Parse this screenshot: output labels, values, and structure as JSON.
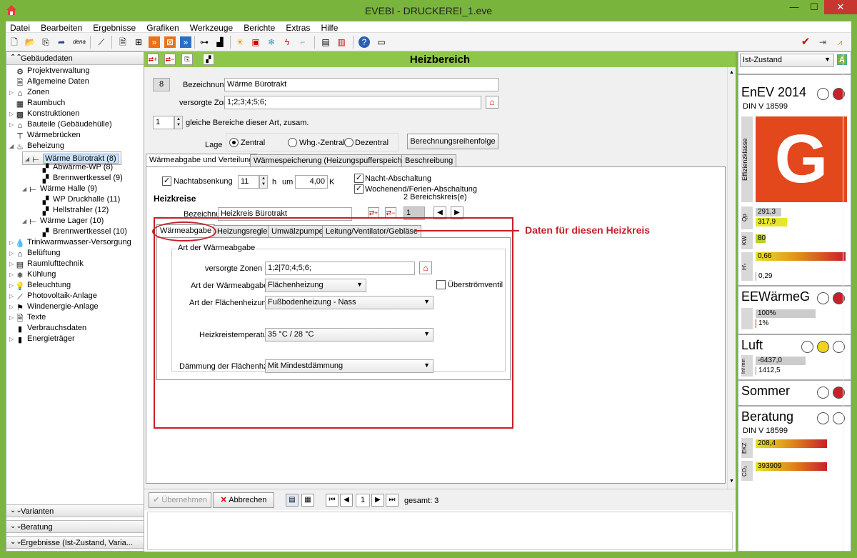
{
  "window": {
    "title": "EVEBI - DRUCKEREI_1.eve",
    "minimize": "—",
    "maximize": "☐",
    "close": "✕"
  },
  "menu": [
    "Datei",
    "Bearbeiten",
    "Ergebnisse",
    "Grafiken",
    "Werkzeuge",
    "Berichte",
    "Extras",
    "Hilfe"
  ],
  "toolbar": {
    "dena_label": "dena"
  },
  "left": {
    "header": "Gebäudedaten",
    "tree": [
      {
        "label": "Projektverwaltung",
        "level": 1,
        "toggle": "",
        "icon": "⚙"
      },
      {
        "label": "Allgemeine Daten",
        "level": 1,
        "toggle": "",
        "icon": "🗎"
      },
      {
        "label": "Zonen",
        "level": 1,
        "toggle": "▷",
        "icon": "⌂"
      },
      {
        "label": "Raumbuch",
        "level": 1,
        "toggle": "",
        "icon": "▦"
      },
      {
        "label": "Konstruktionen",
        "level": 1,
        "toggle": "▷",
        "icon": "▩"
      },
      {
        "label": "Bauteile (Gebäudehülle)",
        "level": 1,
        "toggle": "▷",
        "icon": "⌂"
      },
      {
        "label": "Wärmebrücken",
        "level": 1,
        "toggle": "",
        "icon": "⊤"
      },
      {
        "label": "Beheizung",
        "level": 1,
        "toggle": "◢",
        "icon": "♨"
      },
      {
        "label": "Wärme Bürotrakt (8)",
        "level": 2,
        "toggle": "◢",
        "icon": "⊢",
        "selected": true
      },
      {
        "label": "Abwärme-WP (8)",
        "level": 3,
        "toggle": "",
        "icon": "▞"
      },
      {
        "label": "Brennwertkessel (9)",
        "level": 3,
        "toggle": "",
        "icon": "▞"
      },
      {
        "label": "Wärme Halle (9)",
        "level": 2,
        "toggle": "◢",
        "icon": "⊢"
      },
      {
        "label": "WP Druckhalle (11)",
        "level": 3,
        "toggle": "",
        "icon": "▞"
      },
      {
        "label": "Hellstrahler (12)",
        "level": 3,
        "toggle": "",
        "icon": "▞"
      },
      {
        "label": "Wärme Lager (10)",
        "level": 2,
        "toggle": "◢",
        "icon": "⊢"
      },
      {
        "label": "Brennwertkessel (10)",
        "level": 3,
        "toggle": "",
        "icon": "▞"
      },
      {
        "label": "Trinkwarmwasser-Versorgung",
        "level": 1,
        "toggle": "▷",
        "icon": "💧"
      },
      {
        "label": "Belüftung",
        "level": 1,
        "toggle": "▷",
        "icon": "⌂"
      },
      {
        "label": "Raumlufttechnik",
        "level": 1,
        "toggle": "▷",
        "icon": "▤"
      },
      {
        "label": "Kühlung",
        "level": 1,
        "toggle": "▷",
        "icon": "❄"
      },
      {
        "label": "Beleuchtung",
        "level": 1,
        "toggle": "▷",
        "icon": "💡"
      },
      {
        "label": "Photovoltaik-Anlage",
        "level": 1,
        "toggle": "▷",
        "icon": "⟋"
      },
      {
        "label": "Windenergie-Anlage",
        "level": 1,
        "toggle": "▷",
        "icon": "⚑"
      },
      {
        "label": "Texte",
        "level": 1,
        "toggle": "▷",
        "icon": "🗎"
      },
      {
        "label": "Verbrauchsdaten",
        "level": 1,
        "toggle": "",
        "icon": "▮"
      },
      {
        "label": "Energieträger",
        "level": 1,
        "toggle": "▷",
        "icon": "▮"
      }
    ],
    "bottom_sections": [
      "Varianten",
      "Beratung",
      "Ergebnisse (Ist-Zustand, Varia..."
    ]
  },
  "main": {
    "title": "Heizbereich",
    "number": "8",
    "bezeichnung_label": "Bezeichnung",
    "bezeichnung_value": "Wärme Bürotrakt",
    "zonen_label": "versorgte Zonen",
    "zonen_value": "1;2;3;4;5;6;",
    "count_value": "1",
    "count_label": "gleiche Bereiche dieser Art, zusam.",
    "lage_label": "Lage",
    "lage_options": [
      "Zentral",
      "Whg.-Zentral",
      "Dezentral"
    ],
    "reihenfolge_button": "Berechnungsreihenfolge",
    "tabs": [
      "Wärmeabgabe und Verteilung",
      "Wärmespeicherung (Heizungspufferspeicher)",
      "Beschreibung"
    ],
    "nachtabsenkung_label": "Nachtabsenkung",
    "nacht_hours": "11",
    "h_label": "h",
    "um_label": "um",
    "kelvin_value": "4,00",
    "k_label": "K",
    "nacht_abschaltung": "Nacht-Abschaltung",
    "wochenend": "Wochenend/Ferien-Abschaltung",
    "heizkreise_heading": "Heizkreise",
    "bereichskreis": "2 Bereichskreis(e)",
    "hk_label": "Bezeichnung",
    "hk_value": "Heizkreis Bürotrakt",
    "hk_index": "1",
    "annotation": "Daten für diesen Heizkreis",
    "subtabs": [
      "Wärmeabgabe",
      "Heizungsregler",
      "Umwälzpumpe",
      "Leitung/Ventilator/Gebläse"
    ],
    "group_title": "Art der Wärmeabgabe",
    "vz_label": "versorgte Zonen",
    "vz_value": "1;2|70;4;5;6;",
    "art_label": "Art der Wärmeabgabe",
    "art_value": "Flächenheizung",
    "ueberstroem": "Überströmventil",
    "flaeche_label": "Art der Flächenheizung",
    "flaeche_value": "Fußbodenheizung - Nass",
    "temp_label": "Heizkreistemperatur",
    "temp_value": "35 °C / 28 °C",
    "daemmung_label": "Dämmung der Flächenhzg.",
    "daemmung_value": "Mit Mindestdämmung",
    "uebernehmen": "Übernehmen",
    "abbrechen": "Abbrechen",
    "page_value": "1",
    "gesamt": "gesamt: 3"
  },
  "right": {
    "state": "Ist-Zustand",
    "state_badge": "A",
    "enev": {
      "title": "EnEV 2014",
      "sub": "DIN V 18599",
      "class": "G",
      "class_label": "Effizienzklasse",
      "qp_label": "Qp",
      "qp1": "291,3",
      "qp2": "317,9",
      "kw_label": "KW",
      "kw": "80",
      "ht_label": "H'ₜ",
      "ht1": "0,66",
      "ht2": "0,29"
    },
    "ee": {
      "title": "EEWärmeG",
      "v1": "100%",
      "v2": "1%"
    },
    "luft": {
      "title": "Luft",
      "label": "Inf min",
      "v1": "-6437,0",
      "v2": "1412,5"
    },
    "sommer": {
      "title": "Sommer"
    },
    "beratung": {
      "title": "Beratung",
      "sub": "DIN V 18599",
      "ekz_label": "EKZ",
      "ekz": "208,4",
      "co2_label": "CO₂",
      "co2": "393909"
    }
  },
  "colors": {
    "green": "#7bb540",
    "header_green": "#8ec64b",
    "red": "#c8202a",
    "classG": "#e3471c",
    "yellow": "#f2d21a"
  }
}
